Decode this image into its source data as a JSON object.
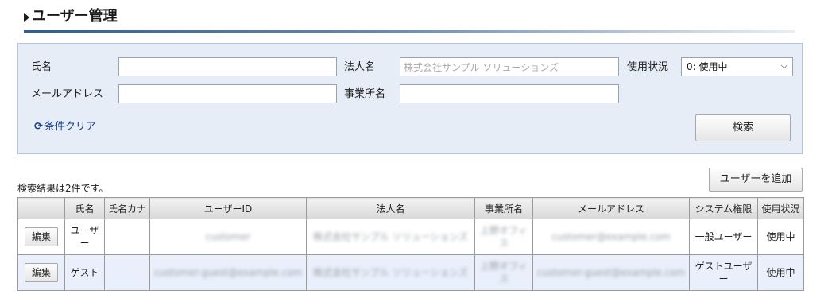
{
  "page": {
    "title": "ユーザー管理"
  },
  "search": {
    "name_label": "氏名",
    "name_value": "",
    "corp_label": "法人名",
    "corp_value": "株式会社サンプル ソリューションズ",
    "status_label": "使用状況",
    "status_selected": "0: 使用中",
    "email_label": "メールアドレス",
    "email_value": "",
    "office_label": "事業所名",
    "office_value": "",
    "clear_label": "条件クリア",
    "search_button": "検索"
  },
  "results": {
    "count_text": "検索結果は2件です。",
    "add_button": "ユーザーを追加",
    "columns": [
      "",
      "氏名",
      "氏名カナ",
      "ユーザーID",
      "法人名",
      "事業所名",
      "メールアドレス",
      "システム権限",
      "使用状況"
    ],
    "rows": [
      {
        "edit": "編集",
        "name": "ユーザー",
        "kana": "",
        "user_id": "customer",
        "corp": "株式会社サンプル ソリューションズ",
        "office": "上野オフィス",
        "email": "customer@example.com",
        "role": "一般ユーザー",
        "status": "使用中"
      },
      {
        "edit": "編集",
        "name": "ゲスト",
        "kana": "",
        "user_id": "customer-guest@example.com",
        "corp": "株式会社サンプル ソリューションズ",
        "office": "上野オフィス",
        "email": "customer-guest@example.com",
        "role": "ゲストユーザー",
        "status": "使用中"
      }
    ]
  }
}
